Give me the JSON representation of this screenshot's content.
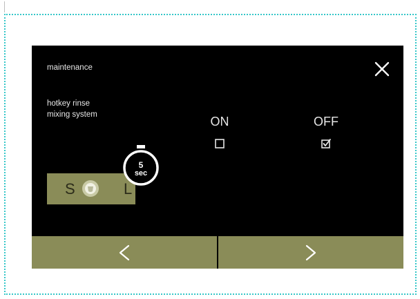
{
  "screen": {
    "title": "maintenance",
    "setting_label_line1": "hotkey rinse",
    "setting_label_line2": "mixing system"
  },
  "options": [
    {
      "label": "ON",
      "checked": false
    },
    {
      "label": "OFF",
      "checked": true
    }
  ],
  "size_selector": {
    "small_label": "S",
    "large_label": "L",
    "icon": "cup-icon"
  },
  "timer": {
    "value": "5",
    "unit": "sec",
    "icon": "stopwatch-icon"
  },
  "icons": {
    "close": "close-icon",
    "prev": "chevron-left-icon",
    "next": "chevron-right-icon",
    "checkbox_empty": "checkbox-empty-icon",
    "checkbox_checked": "checkbox-checked-icon"
  },
  "colors": {
    "screen_bg": "#000000",
    "accent_olive": "#8a8c58",
    "text": "#e6e6e6",
    "frame_border": "#33c6c8"
  }
}
